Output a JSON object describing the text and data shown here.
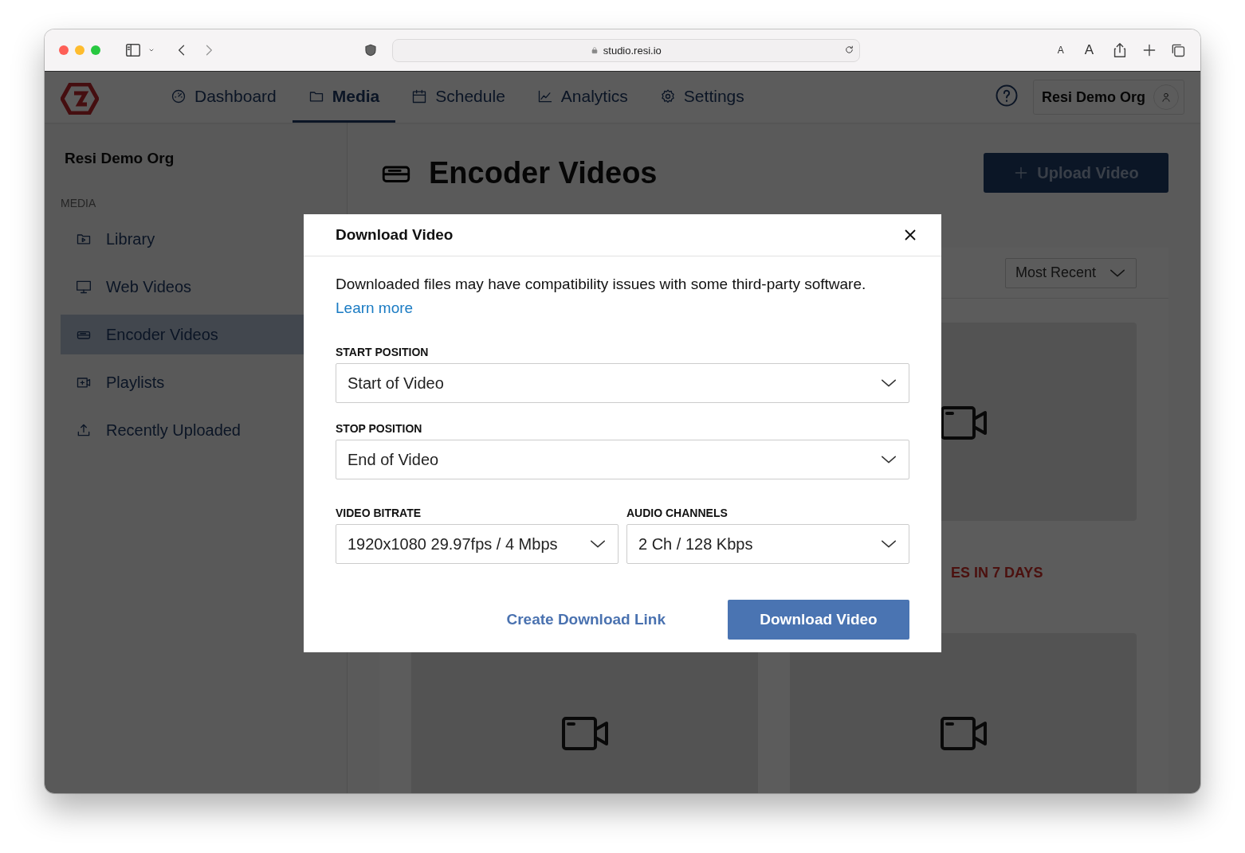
{
  "browser": {
    "url": "studio.resi.io",
    "text_smaller": "A",
    "text_larger": "A"
  },
  "nav": {
    "items": [
      {
        "label": "Dashboard",
        "selected": false
      },
      {
        "label": "Media",
        "selected": true
      },
      {
        "label": "Schedule",
        "selected": false
      },
      {
        "label": "Analytics",
        "selected": false
      },
      {
        "label": "Settings",
        "selected": false
      }
    ],
    "account": "Resi Demo Org"
  },
  "sidebar": {
    "org": "Resi Demo Org",
    "section": "MEDIA",
    "items": [
      {
        "label": "Library",
        "selected": false
      },
      {
        "label": "Web Videos",
        "selected": false
      },
      {
        "label": "Encoder Videos",
        "selected": true
      },
      {
        "label": "Playlists",
        "selected": false
      },
      {
        "label": "Recently Uploaded",
        "selected": false
      }
    ]
  },
  "page": {
    "title": "Encoder Videos",
    "upload_button": "Upload Video",
    "sort": "Most Recent",
    "cards": [
      {
        "kind": "video",
        "status": "ES IN 7 DAYS"
      },
      {
        "kind": "video"
      },
      {
        "kind": "video"
      }
    ]
  },
  "modal": {
    "title": "Download Video",
    "message": "Downloaded files may have compatibility issues with some third-party software.",
    "link": "Learn more",
    "rows": [
      [
        {
          "label": "START POSITION",
          "value": "Start of Video"
        }
      ],
      [
        {
          "label": "STOP POSITION",
          "value": "End of Video"
        }
      ],
      [
        {
          "label": "VIDEO BITRATE",
          "value": "1920x1080 29.97fps / 4 Mbps"
        },
        {
          "label": "AUDIO CHANNELS",
          "value": "2 Ch / 128 Kbps"
        }
      ]
    ],
    "secondary_button": "Create Download Link",
    "primary_button": "Download Video"
  }
}
